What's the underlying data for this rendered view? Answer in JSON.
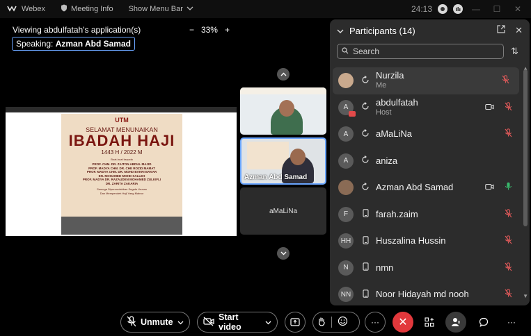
{
  "titlebar": {
    "app_name": "Webex",
    "meeting_info": "Meeting Info",
    "show_menu_bar": "Show Menu Bar",
    "time": "24:13"
  },
  "share": {
    "viewing_label": "Viewing abdulfatah's application(s)",
    "zoom_minus": "−",
    "zoom_level": "33%",
    "zoom_plus": "+",
    "speaking_prefix": "Speaking:",
    "speaking_name": "Azman Abd Samad"
  },
  "poster": {
    "logo": "UTM",
    "line1": "SELAMAT MENUNAIKAN",
    "line2": "IBADAH HAJI",
    "line3": "1443 H / 2022 M",
    "line4": "Buat-buat kepada",
    "names": [
      "PROF. CHM. DR. ZAITON ABDUL MAJID",
      "PROF. MADYA CHM. DR. CHE ROZID MAMAT",
      "PROF. MADYA CHM. DR. MOHD BAKRI BAKAR",
      "EN. MOHAMED MOHD SALLEH",
      "PROF. MADYA DR. RAZAUDEN MOHAMED ZULKIFLI",
      "DR. ZARITA ZAKARIA"
    ],
    "wish1": "Semoga Dipermudahkan Segala Urusan",
    "wish2": "Dan Memperoleh Haji Yang Mabrur"
  },
  "thumbnails": [
    {
      "label": ""
    },
    {
      "label": "Azman Abd Samad"
    },
    {
      "label": "aMaLiNa"
    }
  ],
  "panel": {
    "title": "Participants (14)",
    "search_placeholder": "Search",
    "participants": [
      {
        "initials": "",
        "name": "Nurzila",
        "role": "Me",
        "device": "sync",
        "camera": false,
        "mic": "muted"
      },
      {
        "initials": "A",
        "name": "abdulfatah",
        "role": "Host",
        "device": "sync",
        "camera": true,
        "mic": "muted"
      },
      {
        "initials": "A",
        "name": "aMaLiNa",
        "role": "",
        "device": "sync",
        "camera": false,
        "mic": "muted"
      },
      {
        "initials": "A",
        "name": "aniza",
        "role": "",
        "device": "sync",
        "camera": false,
        "mic": "none"
      },
      {
        "initials": "",
        "name": "Azman Abd Samad",
        "role": "",
        "device": "sync",
        "camera": true,
        "mic": "active"
      },
      {
        "initials": "F",
        "name": "farah.zaim",
        "role": "",
        "device": "phone",
        "camera": false,
        "mic": "muted"
      },
      {
        "initials": "HH",
        "name": "Huszalina Hussin",
        "role": "",
        "device": "phone",
        "camera": false,
        "mic": "muted"
      },
      {
        "initials": "N",
        "name": "nmn",
        "role": "",
        "device": "phone",
        "camera": false,
        "mic": "muted"
      },
      {
        "initials": "NN",
        "name": "Noor Hidayah md nooh",
        "role": "",
        "device": "phone",
        "camera": false,
        "mic": "muted"
      }
    ]
  },
  "toolbar": {
    "unmute_label": "Unmute",
    "start_video_label": "Start video"
  },
  "colors": {
    "accent": "#6aa5ff",
    "end_call": "#e2383c",
    "muted_red": "#e05a5a",
    "active_green": "#38b76b"
  }
}
